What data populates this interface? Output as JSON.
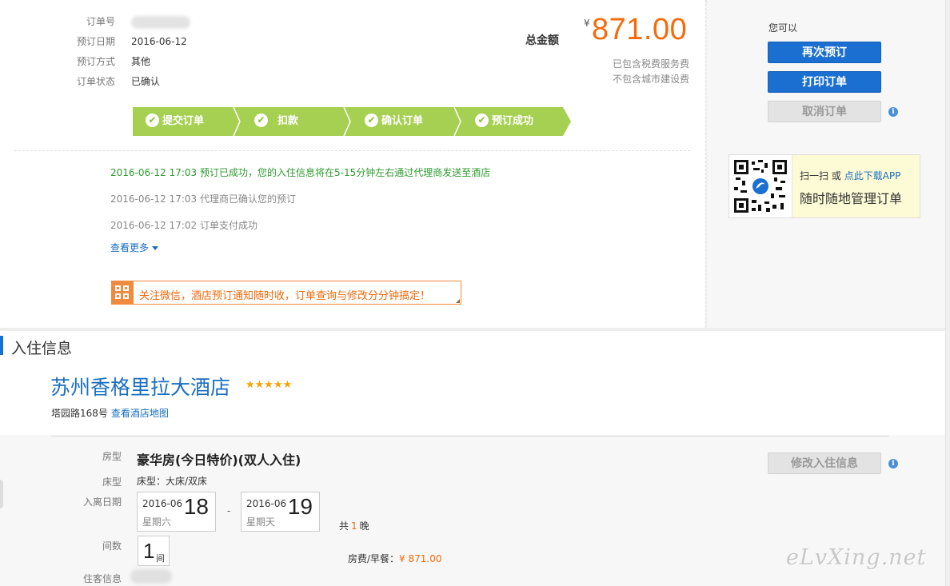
{
  "order": {
    "fields": [
      {
        "label": "订单号",
        "value": ""
      },
      {
        "label": "预订日期",
        "value": "2016-06-12"
      },
      {
        "label": "预订方式",
        "value": "其他"
      },
      {
        "label": "订单状态",
        "value": "已确认"
      }
    ],
    "total_label": "总金额",
    "currency": "¥",
    "total_amount": "871.00",
    "tax_note_1": "已包含税费服务费",
    "tax_note_2": "不包含城市建设费"
  },
  "progress": {
    "steps": [
      "提交订单",
      "扣款",
      "确认订单",
      "预订成功"
    ],
    "color": "#a6d052"
  },
  "logs": [
    {
      "time": "2016-06-12 17:03",
      "text": "预订已成功，您的入住信息将在5-15分钟左右通过代理商发送至酒店"
    },
    {
      "time": "2016-06-12 17:03",
      "text": "代理商已确认您的预订"
    },
    {
      "time": "2016-06-12 17:02",
      "text": "订单支付成功"
    }
  ],
  "more_label": "查看更多",
  "wechat_notice": "关注微信，酒店预订通知随时收，订单查询与修改分分钟搞定！",
  "actions": {
    "you_can": "您可以",
    "rebook": "再次预订",
    "print": "打印订单",
    "cancel": "取消订单",
    "modify": "修改入住信息"
  },
  "app_promo": {
    "scan": "扫一扫",
    "or": "或",
    "download": "点此下载APP",
    "slogan": "随时随地管理订单"
  },
  "checkin": {
    "section_title": "入住信息",
    "hotel_name": "苏州香格里拉大酒店",
    "stars": "★★★★★",
    "address": "塔园路168号",
    "map_link": "查看酒店地图",
    "labels": {
      "room_type": "房型",
      "bed_type": "床型",
      "dates": "入离日期",
      "rooms": "间数",
      "guest": "住客信息"
    },
    "room_type": "豪华房(今日特价)(双人入住)",
    "bed_type": "床型：大床/双床",
    "checkin_date": {
      "ym": "2016-06",
      "day": "18",
      "weekday": "星期六"
    },
    "date_sep": "-",
    "checkout_date": {
      "ym": "2016-06",
      "day": "19",
      "weekday": "星期天"
    },
    "nights_prefix": "共",
    "nights": "1",
    "nights_suffix": "晚",
    "rooms": "1",
    "rooms_unit": "间",
    "fee_label": "房费/早餐：",
    "fee_currency": "¥",
    "fee_amount": "871.00"
  },
  "watermark": "eLvXing.net",
  "colors": {
    "accent": "#1b6fd1",
    "price": "#f56b0c",
    "success": "#2e9a2e"
  }
}
